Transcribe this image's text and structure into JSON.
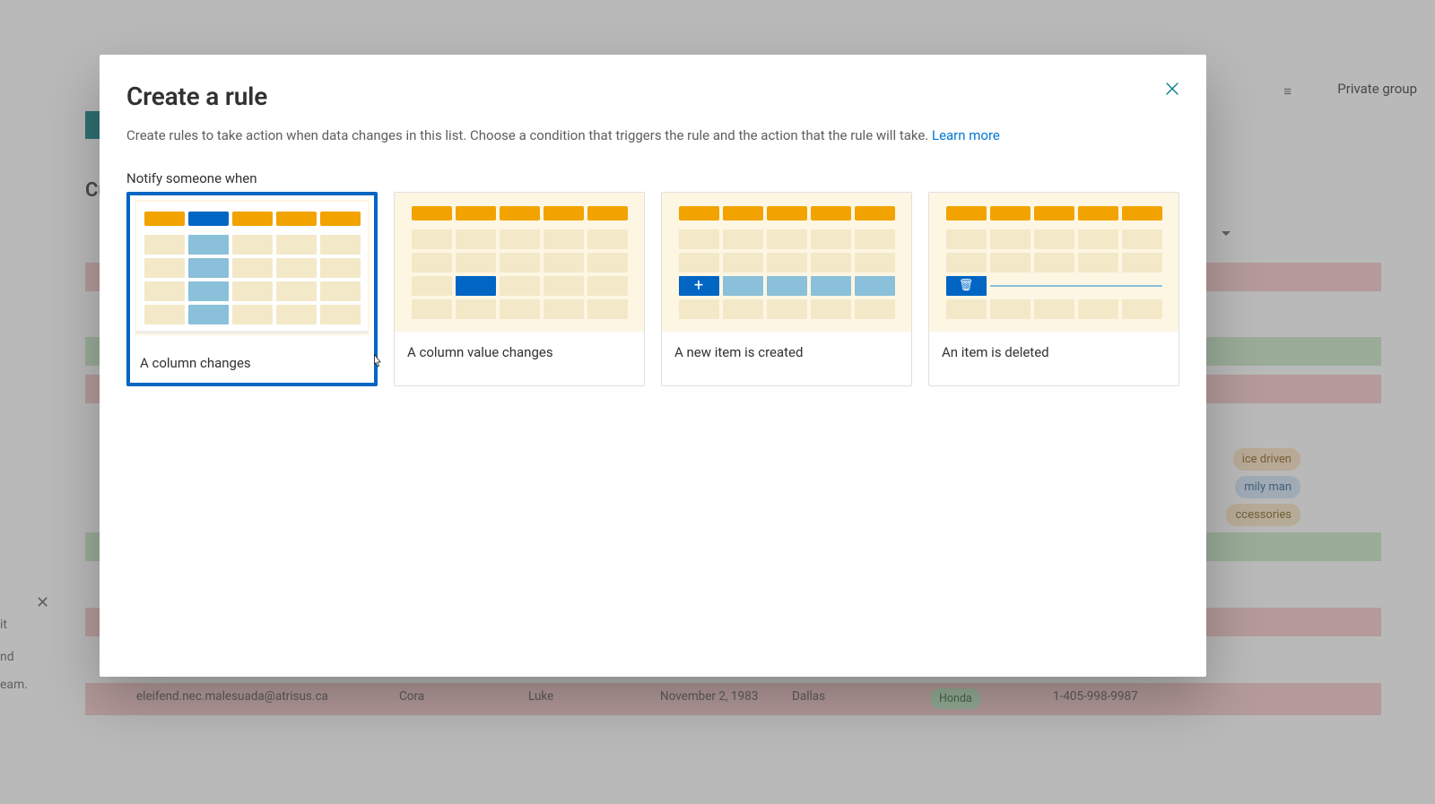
{
  "background": {
    "private_group": "Private group",
    "list_title_fragment": "Cu",
    "side_text1": "it",
    "side_text2": "nd",
    "side_text3": "eam.",
    "row": {
      "email": "eleifend.nec.malesuada@atrisus.ca",
      "first": "Cora",
      "last": "Luke",
      "dob": "November 2, 1983",
      "city": "Dallas",
      "make": "Honda",
      "phone": "1-405-998-9987"
    },
    "pills": {
      "p1": "ice driven",
      "p2": "mily man",
      "p3": "ccessories"
    }
  },
  "modal": {
    "title": "Create a rule",
    "description": "Create rules to take action when data changes in this list. Choose a condition that triggers the rule and the action that the rule will take. ",
    "learn_more": "Learn more",
    "subhead": "Notify someone when",
    "cards": [
      {
        "label": "A column changes"
      },
      {
        "label": "A column value changes"
      },
      {
        "label": "A new item is created"
      },
      {
        "label": "An item is deleted"
      }
    ]
  }
}
